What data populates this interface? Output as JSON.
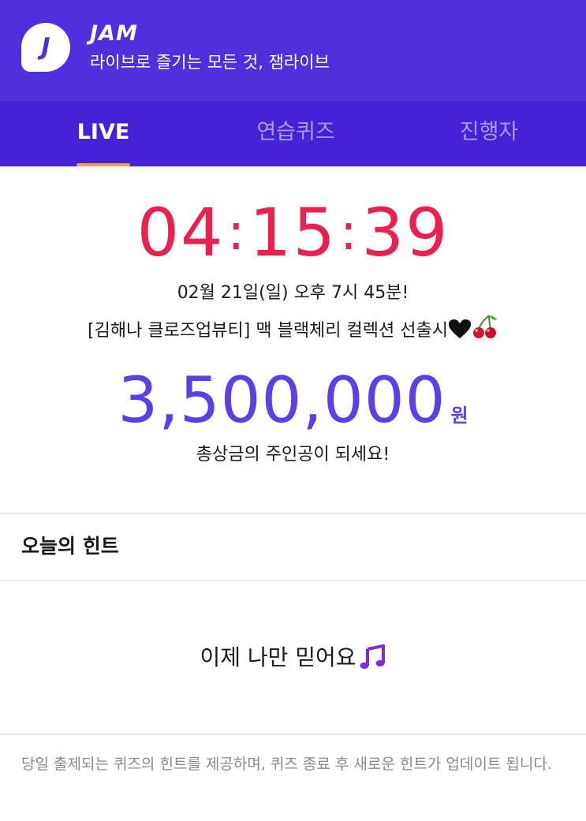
{
  "header": {
    "logo_letter": "J",
    "app_name": "JAM",
    "tagline": "라이브로 즐기는 모든 것, 잼라이브"
  },
  "tabs": [
    {
      "label": "LIVE",
      "active": true
    },
    {
      "label": "연습퀴즈",
      "active": false
    },
    {
      "label": "진행자",
      "active": false
    }
  ],
  "countdown": {
    "hours": "04",
    "minutes": "15",
    "seconds": "39",
    "separator": ":"
  },
  "event": {
    "schedule": "02월 21일(일) 오후 7시 45분!",
    "title": "[김해나 클로즈업뷰티] 맥 블랙체리 컬렉션 선출시"
  },
  "prize": {
    "amount": "3,500,000",
    "unit": "원",
    "caption": "총상금의 주인공이 되세요!"
  },
  "hint": {
    "section_title": "오늘의 힌트",
    "text": "이제 나만 믿어요",
    "footnote": "당일 출제되는 퀴즈의 힌트를 제공하며, 퀴즈 종료 후 새로운 힌트가 업데이트 됩니다."
  },
  "icons": {
    "heart": "black-heart-icon",
    "cherry": "cherries-icon",
    "music": "music-notes-icon"
  },
  "colors": {
    "header_bg": "#4f30df",
    "tabbar_bg": "#4522d8",
    "countdown": "#ea2150",
    "prize": "#5a40e6",
    "tab_indicator": "#f5a14a"
  }
}
